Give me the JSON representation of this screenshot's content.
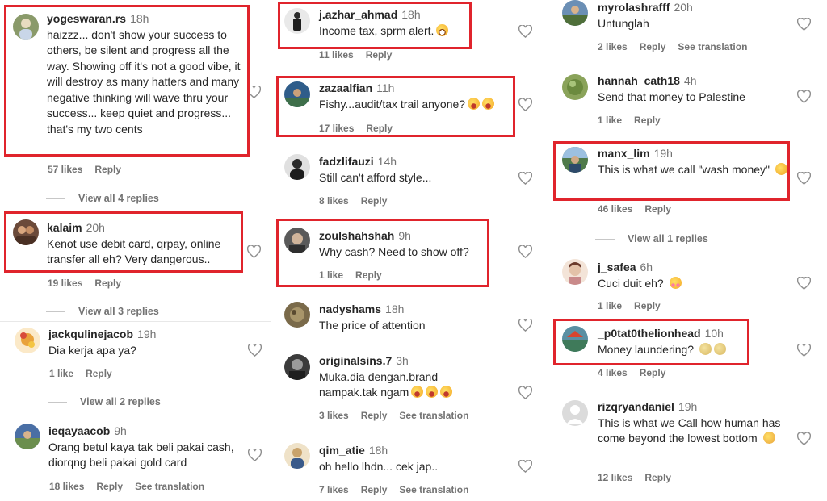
{
  "columns": [
    {
      "comments": [
        {
          "user": "yogeswaran.rs",
          "time": "18h",
          "text": "haizzz... don't show your success to others, be silent and progress all the way. Showing off it's not a good vibe, it will destroy as many hatters and many negative thinking will wave thru your success... keep quiet and progress... that's my two cents",
          "likes": "57 likes",
          "reply": "Reply",
          "view_replies": "View all 4 replies",
          "avatar_color": "#8a9a6a"
        },
        {
          "user": "kalaim",
          "time": "20h",
          "text": "Kenot use debit card, qrpay, online transfer all eh? Very dangerous..",
          "likes": "19 likes",
          "reply": "Reply",
          "view_replies": "View all 3 replies",
          "avatar_color": "#6b4a3a"
        },
        {
          "user": "jackqulinejacob",
          "time": "19h",
          "text": "Dia kerja apa ya?",
          "likes": "1 like",
          "reply": "Reply",
          "view_replies": "View all 2 replies",
          "avatar_color": "#e9c46a"
        },
        {
          "user": "ieqayaacob",
          "time": "9h",
          "text": "Orang betul kaya tak beli pakai cash, diorqng beli pakai gold card",
          "likes": "18 likes",
          "reply": "Reply",
          "see_translation": "See translation",
          "avatar_color": "#4a6fa5"
        }
      ]
    },
    {
      "comments": [
        {
          "user": "j.azhar_ahmad",
          "time": "18h",
          "text": "Income tax, sprm alert.",
          "emoji": [
            "grin"
          ],
          "likes": "11 likes",
          "reply": "Reply",
          "avatar_color": "#3a3a3a"
        },
        {
          "user": "zazaalfian",
          "time": "11h",
          "text": "Fishy...audit/tax trail anyone?",
          "emoji": [
            "laugh",
            "laugh"
          ],
          "likes": "17 likes",
          "reply": "Reply",
          "avatar_color": "#2f5d8a"
        },
        {
          "user": "fadzlifauzi",
          "time": "14h",
          "text": "Still can't afford style...",
          "likes": "8 likes",
          "reply": "Reply",
          "avatar_color": "#2b2b2b"
        },
        {
          "user": "zoulshahshah",
          "time": "9h",
          "text": "Why cash? Need to show off?",
          "likes": "1 like",
          "reply": "Reply",
          "avatar_color": "#5a5a5a"
        },
        {
          "user": "nadyshams",
          "time": "18h",
          "text": "The price of attention",
          "likes": "",
          "reply": "",
          "avatar_color": "#7a6a4a"
        },
        {
          "user": "originalsins.7",
          "time": "3h",
          "text": "Muka.dia dengan.brand nampak.tak ngam",
          "emoji": [
            "laugh",
            "laugh",
            "laugh"
          ],
          "likes": "3 likes",
          "reply": "Reply",
          "see_translation": "See translation",
          "avatar_color": "#3b3b3b"
        },
        {
          "user": "qim_atie",
          "time": "18h",
          "text": "oh hello lhdn... cek jap..",
          "likes": "7 likes",
          "reply": "Reply",
          "see_translation": "See translation",
          "avatar_color": "#c9a36b"
        }
      ]
    },
    {
      "comments": [
        {
          "user": "myrolashrafff",
          "time": "20h",
          "text": "Untunglah",
          "likes": "2 likes",
          "reply": "Reply",
          "see_translation": "See translation",
          "avatar_color": "#6b8fb5"
        },
        {
          "user": "hannah_cath18",
          "time": "4h",
          "text": "Send that money to Palestine",
          "likes": "1 like",
          "reply": "Reply",
          "avatar_color": "#8aa35a"
        },
        {
          "user": "manx_lim",
          "time": "19h",
          "text": "This is what we call \"wash money\"",
          "emoji": [
            "wink"
          ],
          "likes": "46 likes",
          "reply": "Reply",
          "view_replies": "View all 1 replies",
          "avatar_color": "#4f7a4a"
        },
        {
          "user": "j_safea",
          "time": "6h",
          "text": "Cuci duit eh?",
          "emoji": [
            "love"
          ],
          "likes": "1 like",
          "reply": "Reply",
          "avatar_color": "#d8b4a0"
        },
        {
          "user": "_p0tat0thelionhead",
          "time": "10h",
          "text": "Money laundering?",
          "emoji": [
            "neutral",
            "neutral"
          ],
          "likes": "4 likes",
          "reply": "Reply",
          "avatar_color": "#5b8fa3"
        },
        {
          "user": "rizqryandaniel",
          "time": "19h",
          "text": "This is what we Call how human has come beyond the lowest bottom",
          "emoji": [
            "smirk"
          ],
          "likes": "12 likes",
          "reply": "Reply",
          "avatar_color": "#dbdbdb"
        }
      ]
    }
  ],
  "colors": {
    "highlight": "#e0242c",
    "muted": "#737373",
    "text": "#262626"
  },
  "icons": {
    "like": "heart-outline-icon",
    "avatar": "profile-avatar-icon"
  }
}
